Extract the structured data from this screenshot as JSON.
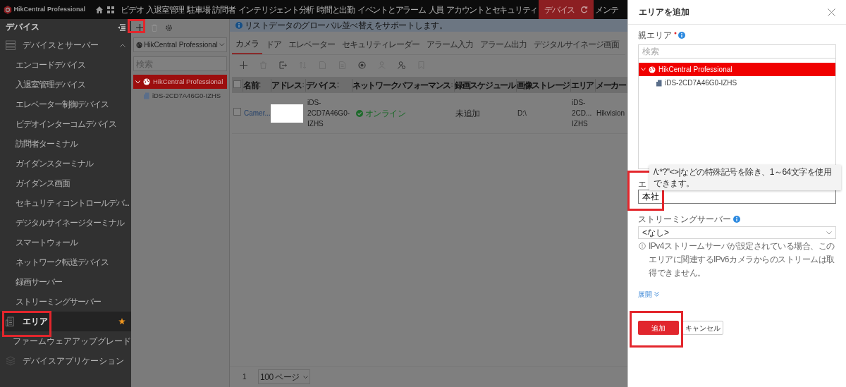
{
  "app": {
    "title": "HikCentral Professional"
  },
  "top_nav": [
    {
      "label": "ビデオ",
      "selected": false
    },
    {
      "label": "入退室管理",
      "selected": false
    },
    {
      "label": "駐車場",
      "selected": false
    },
    {
      "label": "訪問者",
      "selected": false
    },
    {
      "label": "インテリジェント分析",
      "selected": false
    },
    {
      "label": "時間と出勤",
      "selected": false
    },
    {
      "label": "イベントとアラーム",
      "selected": false
    },
    {
      "label": "人員",
      "selected": false
    },
    {
      "label": "アカウントとセキュリティ",
      "selected": false
    },
    {
      "label": "デバイス",
      "selected": true
    },
    {
      "label": "メンテ",
      "selected": false
    }
  ],
  "sidebar": {
    "title": "デバイス",
    "items": [
      {
        "label": "デバイスとサーバー",
        "selected": false,
        "favorite": false,
        "expanded": true,
        "children": [
          {
            "label": "エンコードデバイス",
            "selected": false
          },
          {
            "label": "入退室管理デバイス",
            "selected": false
          },
          {
            "label": "エレベーター制御デバイス",
            "selected": false
          },
          {
            "label": "ビデオインターコムデバイス",
            "selected": false
          },
          {
            "label": "訪問者ターミナル",
            "selected": false
          },
          {
            "label": "ガイダンスターミナル",
            "selected": false
          },
          {
            "label": "ガイダンス画面",
            "selected": false
          },
          {
            "label": "セキュリティコントロールデバ...",
            "selected": false
          },
          {
            "label": "デジタルサイネージターミナル",
            "selected": false
          },
          {
            "label": "スマートウォール",
            "selected": false
          },
          {
            "label": "ネットワーク転送デバイス",
            "selected": false
          },
          {
            "label": "録画サーバー",
            "selected": false
          },
          {
            "label": "ストリーミングサーバー",
            "selected": false
          }
        ]
      },
      {
        "label": "エリア",
        "selected": true,
        "favorite": true
      },
      {
        "label": "ファームウェアアップグレード",
        "selected": false,
        "favorite": false
      },
      {
        "label": "デバイスアプリケーション",
        "selected": false,
        "favorite": false
      }
    ]
  },
  "area_panel": {
    "site_select": "HikCentral Professional",
    "search_placeholder": "検索",
    "tree": [
      {
        "label": "HikCentral Professional",
        "selected": true,
        "expanded": true,
        "children": [
          {
            "label": "iDS-2CD7A46G0-IZHS",
            "selected": false
          }
        ]
      }
    ]
  },
  "notice": "リストデータのグローバル並べ替えをサポートします。",
  "tabs": [
    {
      "label": "カメラ",
      "selected": true
    },
    {
      "label": "ドア",
      "selected": false
    },
    {
      "label": "エレベーター",
      "selected": false
    },
    {
      "label": "セキュリティレーダー",
      "selected": false
    },
    {
      "label": "アラーム入力",
      "selected": false
    },
    {
      "label": "アラーム出力",
      "selected": false
    },
    {
      "label": "デジタルサイネージ画面",
      "selected": false
    }
  ],
  "table": {
    "select_all_checked": false,
    "columns": [
      {
        "label": "名前",
        "sortable": true
      },
      {
        "label": "アドレス",
        "sortable": true
      },
      {
        "label": "デバイス",
        "sortable": true
      },
      {
        "label": "ネットワークパフォーマンス",
        "sortable": true
      },
      {
        "label": "録画スケジュール",
        "sortable": false
      },
      {
        "label": "画像ストレージ",
        "sortable": false
      },
      {
        "label": "エリア",
        "sortable": false
      },
      {
        "label": "メーカー",
        "sortable": false
      }
    ],
    "rows": [
      {
        "checked": false,
        "name": "Camer...",
        "address_redacted": true,
        "device": "iDS-2CD7A46G0-IZHS",
        "network": "オンライン",
        "online": true,
        "schedule": "未追加",
        "storage": "D:\\",
        "area": "iDS-2CD... IZHS",
        "maker": "Hikvision"
      }
    ]
  },
  "pagination": {
    "page": "1",
    "page_size": "100 ページ"
  },
  "dialog": {
    "title": "エリアを追加",
    "parent_label": "親エリア",
    "required": true,
    "search_placeholder": "検索",
    "tree": [
      {
        "label": "HikCentral Professional",
        "selected": true,
        "expanded": true,
        "children": [
          {
            "label": "iDS-2CD7A46G0-IZHS",
            "selected": false
          }
        ]
      }
    ],
    "tooltip": "/\\:*?\"<>|などの特殊記号を除き、1～64文字を使用できます。",
    "name_label": "エ",
    "name_value": "本社",
    "streaming_label": "ストリーミングサーバー",
    "streaming_value": "<なし>",
    "hint": "IPv4ストリームサーバが設定されている場合、このエリアに関連するIPv6カメラからのストリームは取得できません。",
    "expand_link": "展開",
    "buttons": [
      {
        "label": "追加",
        "kind": "primary"
      },
      {
        "label": "キャンセル",
        "kind": "secondary"
      }
    ]
  }
}
